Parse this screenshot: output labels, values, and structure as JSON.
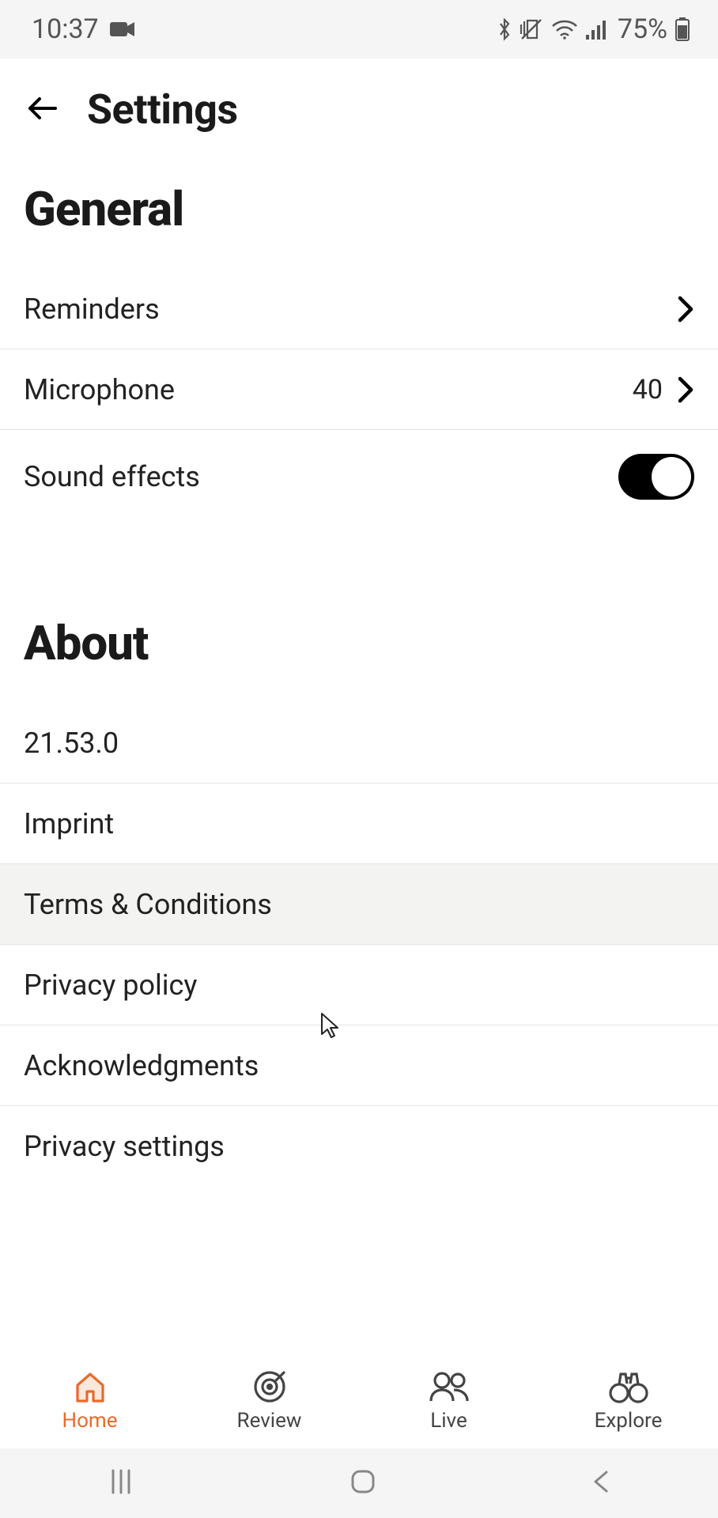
{
  "status": {
    "time": "10:37",
    "battery_pct": "75%"
  },
  "header": {
    "title": "Settings"
  },
  "sections": {
    "general": {
      "label": "General",
      "reminders": "Reminders",
      "microphone_label": "Microphone",
      "microphone_value": "40",
      "sound_effects": "Sound effects",
      "sound_effects_on": true
    },
    "about": {
      "label": "About",
      "version": "21.53.0",
      "imprint": "Imprint",
      "terms": "Terms & Conditions",
      "privacy_policy": "Privacy policy",
      "acknowledgments": "Acknowledgments",
      "privacy_settings": "Privacy settings"
    }
  },
  "nav": {
    "home": "Home",
    "review": "Review",
    "live": "Live",
    "explore": "Explore",
    "active": "home"
  }
}
